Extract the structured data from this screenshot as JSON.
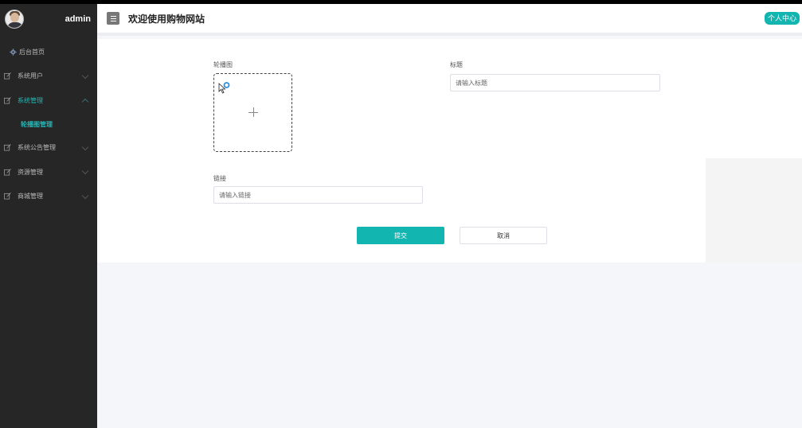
{
  "sidebar": {
    "username": "admin",
    "menu": [
      {
        "label": "后台首页"
      },
      {
        "label": "系统用户"
      },
      {
        "label": "系统管理"
      },
      {
        "label": "系统公告管理"
      },
      {
        "label": "资源管理"
      },
      {
        "label": "商城管理"
      }
    ],
    "submenu_active": "轮播图管理"
  },
  "header": {
    "title": "欢迎使用购物网站",
    "personal_center": "个人中心"
  },
  "form": {
    "carousel_label": "轮播图",
    "title_label": "标题",
    "title_placeholder": "请输入标题",
    "link_label": "链接",
    "link_placeholder": "请输入链接",
    "submit_label": "提交",
    "cancel_label": "取消"
  },
  "colors": {
    "accent": "#13b5b1",
    "sidebar_bg": "#262626"
  }
}
